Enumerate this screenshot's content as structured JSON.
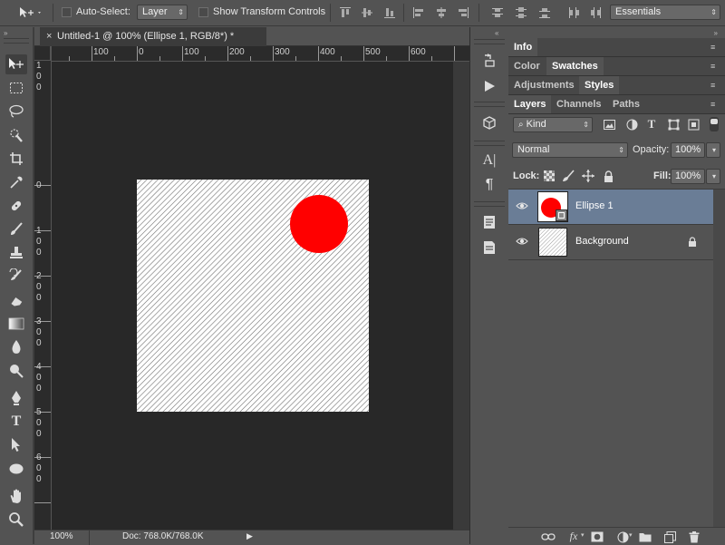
{
  "options_bar": {
    "auto_select_label": "Auto-Select:",
    "auto_select_target": "Layer",
    "show_transform_label": "Show Transform Controls",
    "workspace": "Essentials"
  },
  "document": {
    "tab_title": "Untitled-1 @ 100% (Ellipse 1, RGB/8*) *",
    "zoom": "100%",
    "doc_size": "Doc: 768.0K/768.0K",
    "h_ruler": [
      "100",
      "0",
      "100",
      "200",
      "300",
      "400",
      "500",
      "600"
    ],
    "v_ruler": [
      [
        "1",
        "0",
        "0"
      ],
      [
        "0"
      ],
      [
        "1",
        "0",
        "0"
      ],
      [
        "2",
        "0",
        "0"
      ],
      [
        "3",
        "0",
        "0"
      ],
      [
        "4",
        "0",
        "0"
      ],
      [
        "5",
        "0",
        "0"
      ],
      [
        "6",
        "0",
        "0"
      ]
    ]
  },
  "panels": {
    "info_tab": "Info",
    "color_tab": "Color",
    "swatches_tab": "Swatches",
    "adjustments_tab": "Adjustments",
    "styles_tab": "Styles",
    "layers_tab": "Layers",
    "channels_tab": "Channels",
    "paths_tab": "Paths"
  },
  "layers_panel": {
    "kind_filter": "Kind",
    "blend_mode": "Normal",
    "opacity_label": "Opacity:",
    "opacity_value": "100%",
    "lock_label": "Lock:",
    "fill_label": "Fill:",
    "fill_value": "100%",
    "layers": [
      {
        "name": "Ellipse 1",
        "selected": true
      },
      {
        "name": "Background",
        "selected": false,
        "locked": true
      }
    ]
  },
  "colors": {
    "ellipse_fill": "#ff0000",
    "selected_layer": "#6a7d96",
    "app_background": "#535353",
    "canvas_background": "#282828"
  }
}
